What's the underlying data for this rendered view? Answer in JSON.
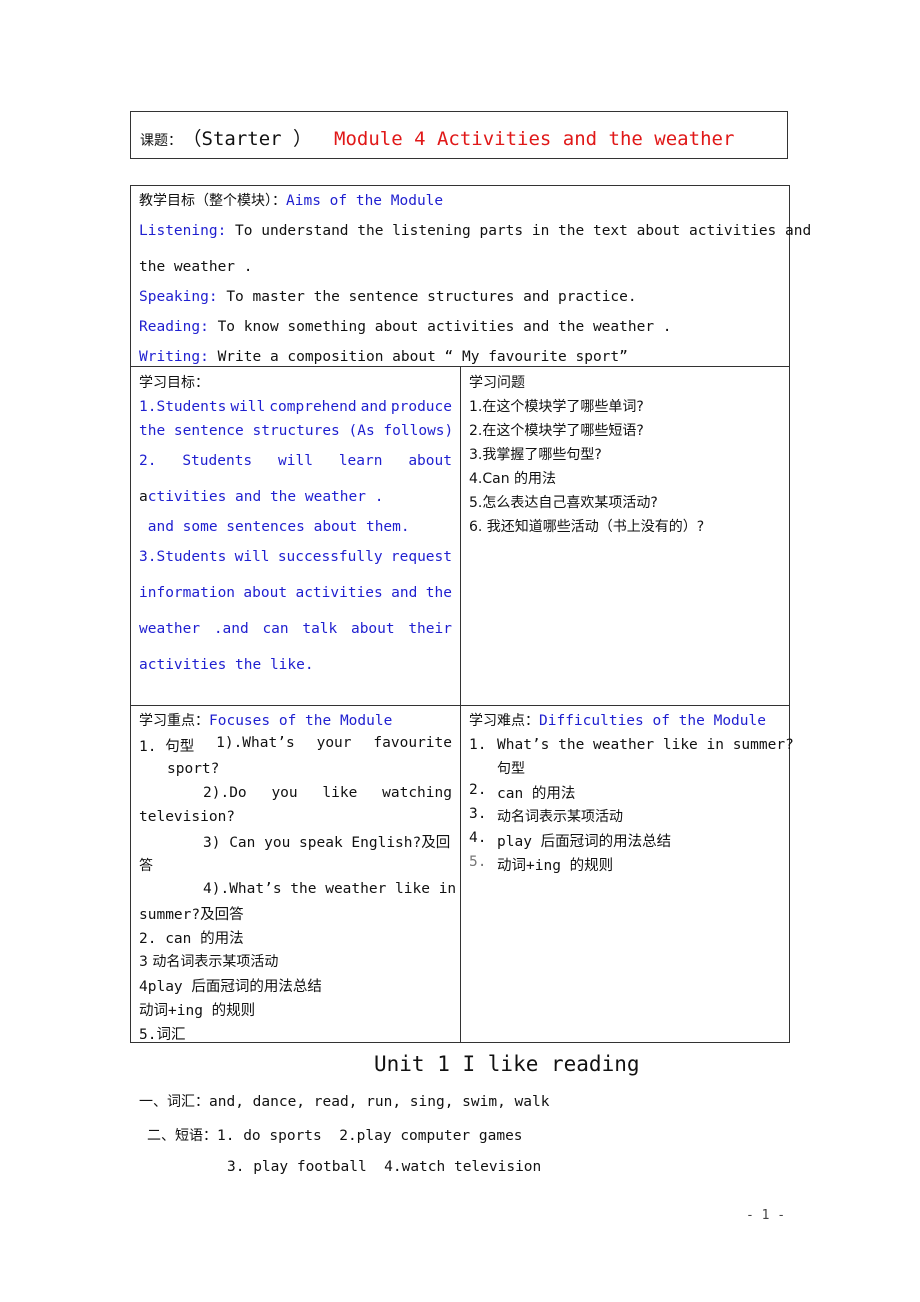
{
  "title": {
    "label": "课题：",
    "starter": "（Starter ）",
    "module": "Module 4 Activities and the weather"
  },
  "aims": {
    "heading_cn": "教学目标（整个模块）：",
    "heading_en": "Aims of the Module",
    "listening_label": "Listening:",
    "listening_text_1": "To understand  the listening parts in the text about activities and",
    "listening_text_2": "the weather .",
    "speaking_label": "Speaking:",
    "speaking_text": "To master the sentence structures and practice.",
    "reading_label": "Reading:",
    "reading_text": "To know something about activities and the weather .",
    "writing_label": "Writing:",
    "writing_text": "Write a composition about “ My favourite sport”"
  },
  "objectives": {
    "heading": "学习目标：",
    "item1_line1": [
      "1.Students",
      "will",
      "comprehend",
      "and",
      "produce"
    ],
    "item1_line2": "the sentence structures (As follows)",
    "item2_line1": [
      "2.",
      "Students",
      "will",
      "learn",
      "about"
    ],
    "item2_line2_first": "a",
    "item2_line2_rest": "ctivities and the weather .",
    "item2_line3": " and some sentences about them.",
    "item3_line1": [
      "3.Students",
      "will",
      "successfully",
      "request"
    ],
    "item3_line2": [
      "information",
      "about",
      "activities",
      "and",
      "the"
    ],
    "item3_line3": [
      "weather",
      ".and",
      "can",
      "talk",
      "about",
      "their"
    ],
    "item3_line4": "activities the like."
  },
  "questions": {
    "heading": "学习问题",
    "items": [
      "1.在这个模块学了哪些单词?",
      "2.在这个模块学了哪些短语?",
      "3.我掌握了哪些句型?",
      "4.Can 的用法",
      "5.怎么表达自己喜欢某项活动?",
      "6. 我还知道哪些活动（书上没有的）?"
    ]
  },
  "focuses": {
    "heading_cn": "学习重点：",
    "heading_en": "Focuses of the Module",
    "line1": [
      "1. 句型",
      "1).What’s",
      "your",
      "favourite"
    ],
    "line2": "sport?",
    "line3": [
      "2).Do",
      "you",
      "like",
      "watching"
    ],
    "line4": "television?",
    "line5": "3) Can you speak English?及回",
    "line6": "答",
    "line7": "4).What’s the weather like in",
    "line8": "summer?及回答",
    "line9": "2. can 的用法",
    "line10": "3 动名词表示某项活动",
    "line11": "4play 后面冠词的用法总结",
    "line12": "动词+ing 的规则",
    "line13": "5.词汇"
  },
  "difficulties": {
    "heading_cn": "学习难点：",
    "heading_en": "Difficulties of the Module",
    "items": [
      {
        "num": "1.",
        "text": "What’s the weather like in summer?",
        "cont": "句型"
      },
      {
        "num": "2.",
        "text": "can 的用法"
      },
      {
        "num": "3.",
        "text": "动名词表示某项活动"
      },
      {
        "num": "4.",
        "text": "play 后面冠词的用法总结"
      },
      {
        "num": "5.",
        "text": "动词+ing 的规则"
      }
    ]
  },
  "unit": {
    "title": "Unit 1 I like reading",
    "vocab_label": "一、词汇：",
    "vocab_words": "and, dance, read, run, sing, swim, walk",
    "phrase_label": "二、短语：",
    "phrases_line1": "1. do sports  2.play computer games",
    "phrases_line2": "3. play football  4.watch television"
  },
  "page_number": "- 1 -",
  "colors": {
    "accent_blue": "#1f1fd0",
    "title_red": "#e01818",
    "border": "#333333"
  }
}
